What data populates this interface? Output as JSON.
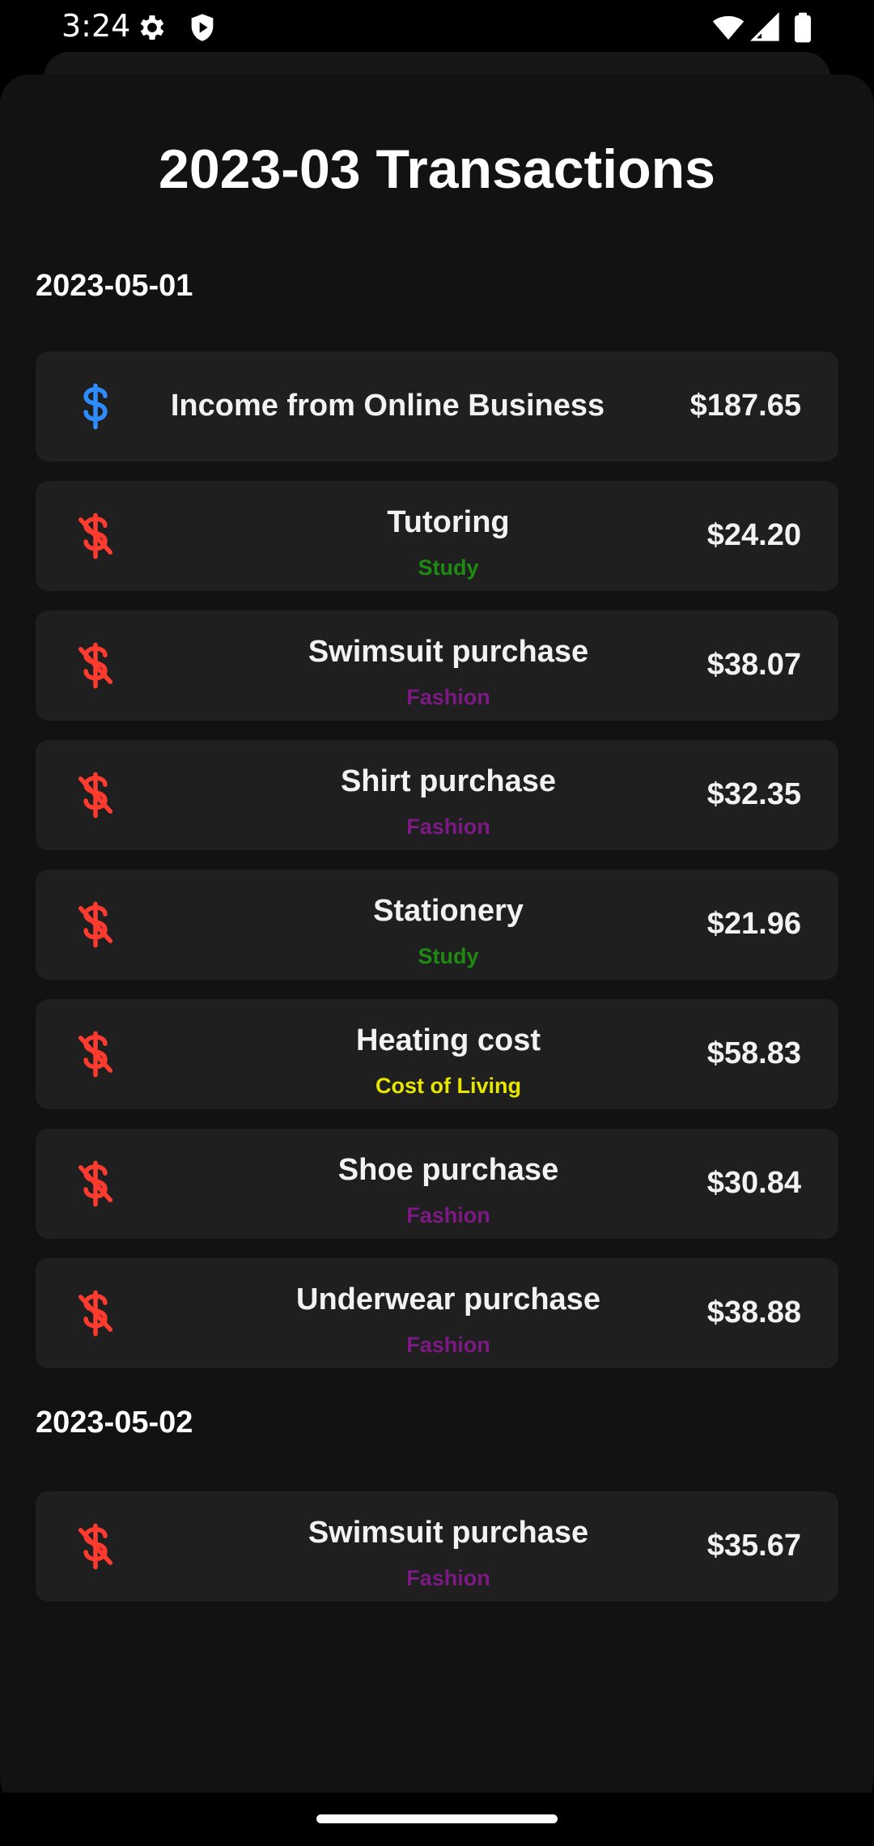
{
  "status_bar": {
    "time": "3:24",
    "icons": [
      "gear-icon",
      "shield-play-icon",
      "wifi-icon",
      "cellular-signal-icon",
      "battery-icon"
    ]
  },
  "title": "2023-03 Transactions",
  "colors": {
    "income": "#2f8cff",
    "expense": "#ff3b30",
    "Study": "#1e8a12",
    "Fashion": "#7a1a82",
    "Cost of Living": "#e6e600"
  },
  "groups": [
    {
      "date": "2023-05-01",
      "items": [
        {
          "name": "Income from Online Business",
          "category": "",
          "amount": "$187.65",
          "type": "income",
          "icon": "dollar-icon"
        },
        {
          "name": "Tutoring",
          "category": "Study",
          "amount": "$24.20",
          "type": "expense",
          "icon": "dollar-off-icon"
        },
        {
          "name": "Swimsuit purchase",
          "category": "Fashion",
          "amount": "$38.07",
          "type": "expense",
          "icon": "dollar-off-icon"
        },
        {
          "name": "Shirt purchase",
          "category": "Fashion",
          "amount": "$32.35",
          "type": "expense",
          "icon": "dollar-off-icon"
        },
        {
          "name": "Stationery",
          "category": "Study",
          "amount": "$21.96",
          "type": "expense",
          "icon": "dollar-off-icon"
        },
        {
          "name": "Heating cost",
          "category": "Cost of Living",
          "amount": "$58.83",
          "type": "expense",
          "icon": "dollar-off-icon"
        },
        {
          "name": "Shoe purchase",
          "category": "Fashion",
          "amount": "$30.84",
          "type": "expense",
          "icon": "dollar-off-icon"
        },
        {
          "name": "Underwear purchase",
          "category": "Fashion",
          "amount": "$38.88",
          "type": "expense",
          "icon": "dollar-off-icon"
        }
      ]
    },
    {
      "date": "2023-05-02",
      "items": [
        {
          "name": "Swimsuit purchase",
          "category": "Fashion",
          "amount": "$35.67",
          "type": "expense",
          "icon": "dollar-off-icon"
        }
      ]
    }
  ]
}
